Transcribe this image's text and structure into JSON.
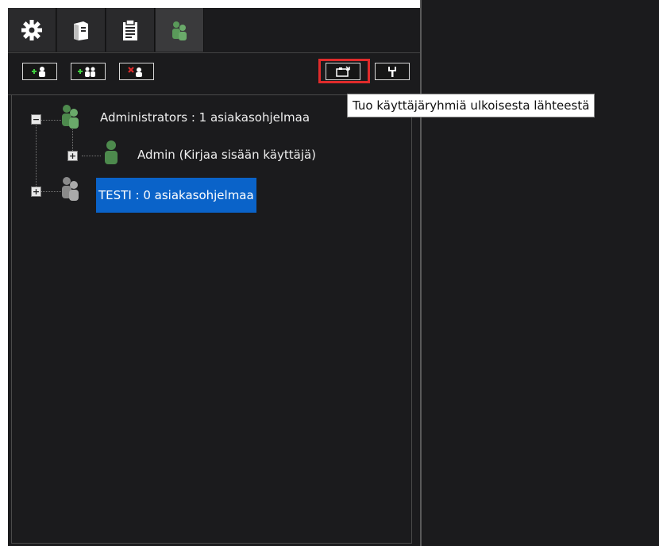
{
  "tabs": [
    {
      "icon": "gear-icon"
    },
    {
      "icon": "server-icon"
    },
    {
      "icon": "clipboard-icon"
    },
    {
      "icon": "users-icon",
      "active": true
    }
  ],
  "toolbar": {
    "buttons": [
      {
        "icon": "add-user-icon"
      },
      {
        "icon": "add-group-icon"
      },
      {
        "icon": "delete-icon"
      },
      {
        "icon": "import-icon",
        "highlighted": true
      },
      {
        "icon": "tools-icon"
      }
    ]
  },
  "tree": {
    "nodes": [
      {
        "label": "Administrators : 1 asiakasohjelmaa",
        "expanded": true,
        "icon": "group-icon-green"
      },
      {
        "label": "Admin (Kirjaa sisään käyttäjä)",
        "icon": "user-icon-green"
      },
      {
        "label": "TESTI : 0 asiakasohjelmaa",
        "selected": true,
        "icon": "group-icon-gray"
      }
    ],
    "expander_minus": "−",
    "expander_plus": "+"
  },
  "tooltip": {
    "text": "Tuo käyttäjäryhmiä ulkoisesta lähteestä"
  },
  "colors": {
    "panel_bg": "#1b1b1d",
    "selection": "#0a63c9",
    "highlight": "#e02b2b",
    "group_green": "#5a9a5a"
  }
}
